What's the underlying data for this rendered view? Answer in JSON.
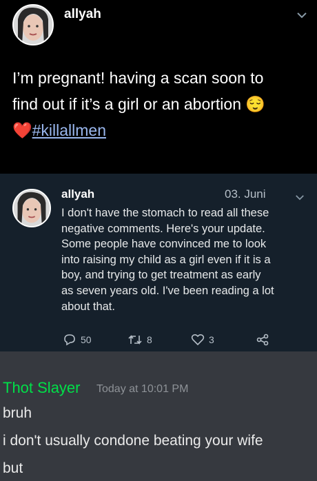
{
  "tweet1": {
    "username": "allyah",
    "line1": "I’m pregnant! having a scan soon to",
    "line2": "find out if it’s a girl or an abortion",
    "emoji": "😌",
    "heart_emoji": "❤️",
    "hashtag": "#killallmen"
  },
  "tweet2": {
    "username": "allyah",
    "date": "03. Juni",
    "lines": [
      "I don't have the stomach to read all these",
      "negative comments. Here's your update.",
      "Some people have convinced me to look",
      "into raising my child as a girl even if it is a",
      "boy, and trying to get treatment as early",
      "as seven years old. I've been reading a lot",
      "about that."
    ],
    "reply_count": "50",
    "retweet_count": "8",
    "like_count": "3"
  },
  "discord": {
    "username": "Thot Slayer",
    "timestamp": "Today at 10:01 PM",
    "username_color": "#00e048",
    "lines": [
      "bruh",
      "i don't usually condone beating your wife",
      "but"
    ]
  }
}
